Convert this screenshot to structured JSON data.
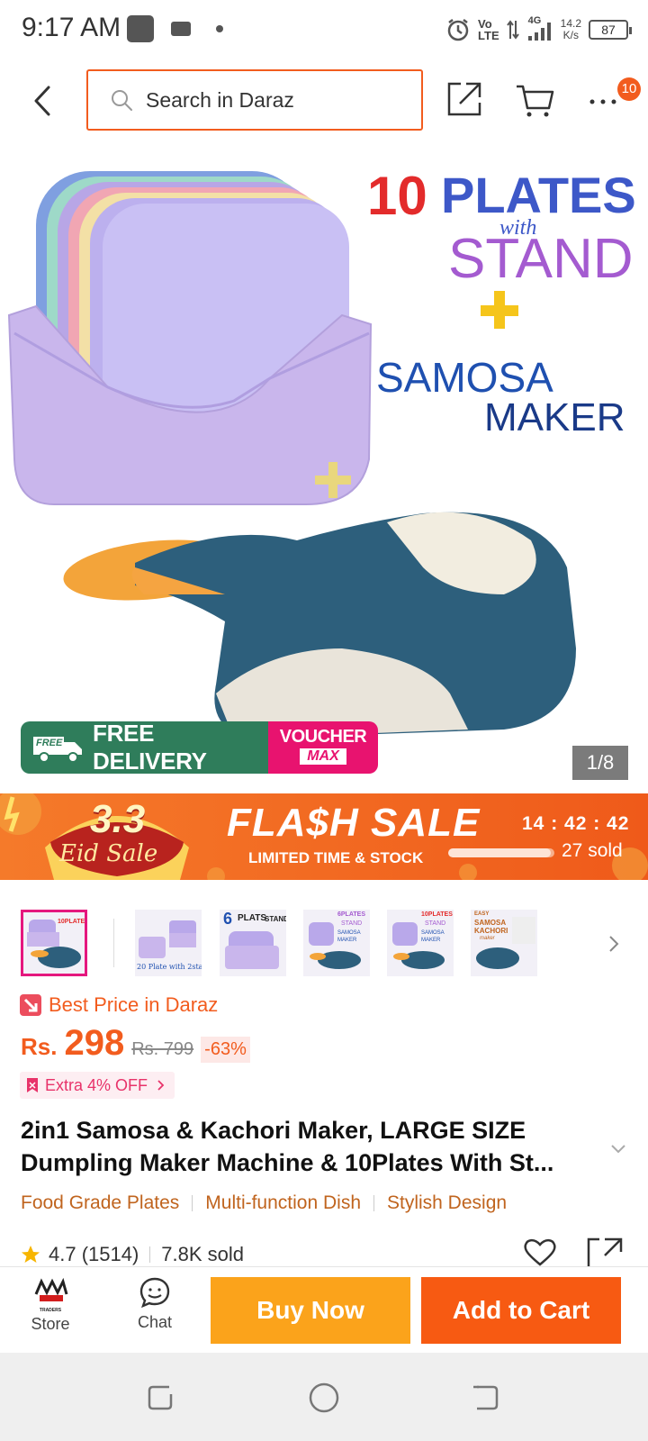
{
  "status_bar": {
    "time": "9:17 AM",
    "net_lines": [
      "Vo",
      "LTE"
    ],
    "net_gen": "4G",
    "speed_lines": [
      "14.2",
      "K/s"
    ],
    "battery": "87"
  },
  "top_bar": {
    "search_placeholder": "Search in Daraz",
    "more_badge": "10"
  },
  "hero": {
    "headline": {
      "num": "10",
      "word": "PLATES",
      "with": "with",
      "stand": "STAND",
      "samosa": "SAMOSA",
      "maker": "MAKER"
    },
    "free_delivery_tag": "FREE",
    "free_delivery": "FREE DELIVERY",
    "voucher_line1": "VOUCHER",
    "voucher_line2": "MAX",
    "image_counter": "1/8"
  },
  "flash_sale": {
    "badge_top": "3.3",
    "badge_bottom": "Eid Sale",
    "title": "FLA$H SALE",
    "subtitle": "LIMITED TIME & STOCK",
    "countdown": "14 : 42 : 42",
    "sold_text": "27 sold",
    "progress_fraction": 0.97
  },
  "thumbnails": {
    "thumb2_caption": "20 Plate with 2stand",
    "thumb3_caption": [
      "6",
      "PLATS",
      "STAND"
    ],
    "thumb4_caption": [
      "6PLATES",
      "STAND",
      "SAMOSA MAKER"
    ],
    "thumb5_caption": [
      "10PLATES",
      "STAND",
      "SAMOSA MAKER"
    ],
    "thumb6_caption": [
      "EASY",
      "SAMOSA",
      "KACHORI",
      "maker"
    ]
  },
  "product": {
    "best_price": "Best Price in Daraz",
    "currency": "Rs.",
    "price": "298",
    "old_price": "Rs. 799",
    "discount": "-63%",
    "extra_off": "Extra 4% OFF",
    "title": "2in1 Samosa & Kachori Maker, LARGE SIZE Dumpling Maker Machine & 10Plates With St...",
    "tags": [
      "Food Grade Plates",
      "Multi-function Dish",
      "Stylish Design"
    ],
    "rating": "4.7 (1514)",
    "sold": "7.8K sold"
  },
  "bottom_bar": {
    "store_logo_text": "TRADERS",
    "store_label": "Store",
    "chat_label": "Chat",
    "buy_now": "Buy Now",
    "add_to_cart": "Add to Cart"
  },
  "colors": {
    "accent": "#f25c1e",
    "buy_now": "#fba31b",
    "add_to_cart": "#f75a12",
    "free_delivery": "#2f7d5b",
    "voucher": "#e8136f"
  }
}
